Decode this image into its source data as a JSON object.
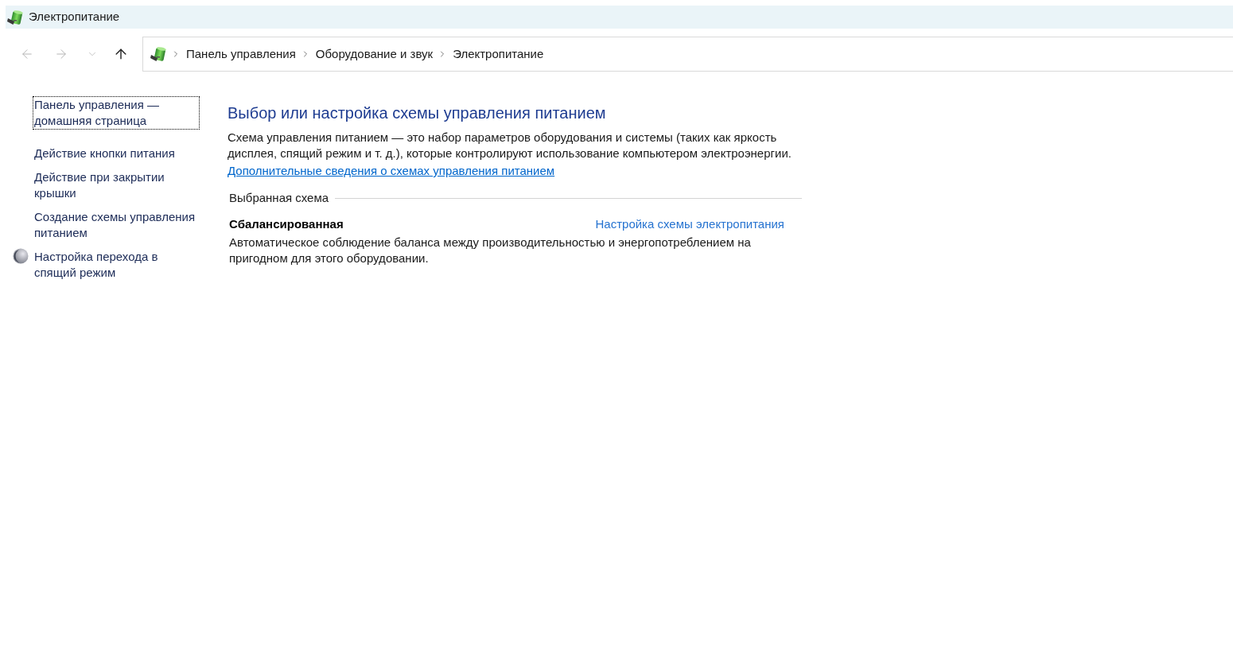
{
  "window": {
    "title": "Электропитание"
  },
  "navigation": {
    "buttons": [
      {
        "kind": "back",
        "disabled": true
      },
      {
        "kind": "forward",
        "disabled": true
      },
      {
        "kind": "recent",
        "disabled": true
      },
      {
        "kind": "up",
        "disabled": false
      }
    ]
  },
  "address_bar": {
    "breadcrumbs": [
      "Панель управления",
      "Оборудование и звук",
      "Электропитание"
    ]
  },
  "sidebar": {
    "items": [
      {
        "kind": "link",
        "label": "Панель управления — домашняя страница",
        "focused": true
      },
      {
        "kind": "link",
        "label": "Действие кнопки питания",
        "focused": false
      },
      {
        "kind": "link",
        "label": "Действие при закрытии крышки",
        "focused": false
      },
      {
        "kind": "link",
        "label": "Создание схемы управления питанием",
        "focused": false
      },
      {
        "kind": "icon_link",
        "label": "Настройка перехода в спящий режим",
        "focused": false
      }
    ]
  },
  "main": {
    "heading": "Выбор или настройка схемы управления питанием",
    "description": "Схема управления питанием — это набор параметров оборудования и системы (таких как яркость дисплея, спящий режим и т. д.), которые контролируют использование компьютером электроэнергии.",
    "more_info_link": "Дополнительные сведения о схемах управления питанием",
    "selected_section": {
      "title": "Выбранная схема",
      "plan": {
        "name": "Сбалансированная",
        "settings_link": "Настройка схемы электропитания",
        "description": "Автоматическое соблюдение баланса между производительностью и энергопотреблением на пригодном для этого оборудовании."
      }
    }
  }
}
